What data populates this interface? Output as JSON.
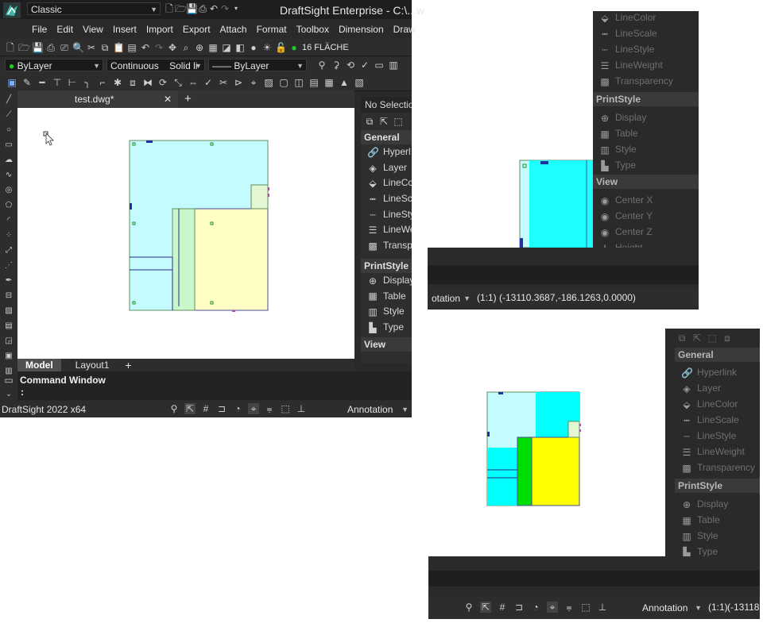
{
  "titlebar": {
    "workspace": "Classic",
    "title": "DraftSight Enterprise - C:\\...w"
  },
  "menubar": {
    "items": [
      "File",
      "Edit",
      "View",
      "Insert",
      "Import",
      "Export",
      "Attach",
      "Format",
      "Toolbox",
      "Dimension",
      "Draw"
    ]
  },
  "toolbar_layers": {
    "layer_text": "16 FLÄCHE"
  },
  "toolbar_props": {
    "color": "ByLayer",
    "linestyle": "Continuous",
    "linestyle_pattern": "Solid li",
    "lineweight": "ByLayer"
  },
  "document": {
    "tab_name": "test.dwg*",
    "close": "✕",
    "add": "+"
  },
  "sheets": {
    "tabs": [
      "Model",
      "Layout1"
    ],
    "add": "+"
  },
  "command_window": {
    "title": "Command Window",
    "prompt": ":"
  },
  "statusbar": {
    "app_version": "DraftSight 2022 x64",
    "annotation": "Annotation",
    "scale": "(1:1)",
    "coords": "(-13110.3687,-186.1263,0.0000)",
    "coords_short": "(-13118",
    "annotation_cut": "otation"
  },
  "properties": {
    "selection": "No Selection",
    "general_header": "General",
    "general": [
      "Hyperlink",
      "Layer",
      "LineColor",
      "LineScale",
      "LineStyle",
      "LineWeight",
      "Transparency"
    ],
    "general_cut": [
      "Hyperl",
      "Layer",
      "LineCo",
      "LineSc",
      "LineSty",
      "LineWe",
      "Transp"
    ],
    "printstyle_header": "PrintStyle",
    "printstyle": [
      "Display",
      "Table",
      "Style",
      "Type"
    ],
    "printstyle_cut": [
      "Display",
      "Table",
      "Style",
      "Type"
    ],
    "view_header": "View",
    "view": [
      "Center X",
      "Center Y",
      "Center Z",
      "Height"
    ]
  },
  "colors": {
    "cyan_light": "#c4fbff",
    "yellow_light": "#fffec5",
    "cyan": "#00ffff",
    "yellow": "#ffff00",
    "green": "#00dd00",
    "dark_bg": "#2a2a2a"
  }
}
